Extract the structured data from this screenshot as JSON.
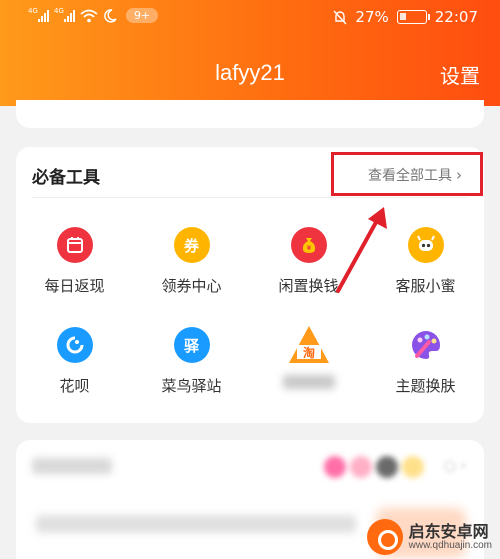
{
  "status_bar": {
    "signal1_label": "4G",
    "signal2_label": "4G",
    "notification_badge": "9+",
    "battery": "27%",
    "battery_level": 0.27,
    "time": "22:07"
  },
  "header": {
    "title": "lafyy21",
    "settings_label": "设置"
  },
  "tools": {
    "section_title": "必备工具",
    "view_all_label": "查看全部工具",
    "items": [
      {
        "label": "每日返现",
        "icon": "calendar-cashback-icon",
        "color": "#f0343f"
      },
      {
        "label": "领券中心",
        "icon": "coupon-icon",
        "color": "#ffb400"
      },
      {
        "label": "闲置换钱",
        "icon": "money-bag-icon",
        "color": "#f0343f"
      },
      {
        "label": "客服小蜜",
        "icon": "customer-service-icon",
        "color": "#ffb400"
      },
      {
        "label": "花呗",
        "icon": "huabei-icon",
        "color": "#1a9bff"
      },
      {
        "label": "菜鸟驿站",
        "icon": "cainiao-station-icon",
        "color": "#1a9bff"
      },
      {
        "label": "",
        "icon": "taobao-triangle-icon",
        "color": "#ff8a00"
      },
      {
        "label": "主题换肤",
        "icon": "theme-palette-icon",
        "color": "#8a52e6"
      }
    ],
    "icon_text": {
      "coupon": "券",
      "cainiao": "驿",
      "taobao": "淘"
    }
  },
  "accents": {
    "highlight": "#e0202b",
    "header_gradient_start": "#ff9a1a",
    "header_gradient_end": "#ff4d10"
  },
  "watermark": {
    "name": "启东安卓网",
    "url": "www.qdhuajin.com"
  }
}
